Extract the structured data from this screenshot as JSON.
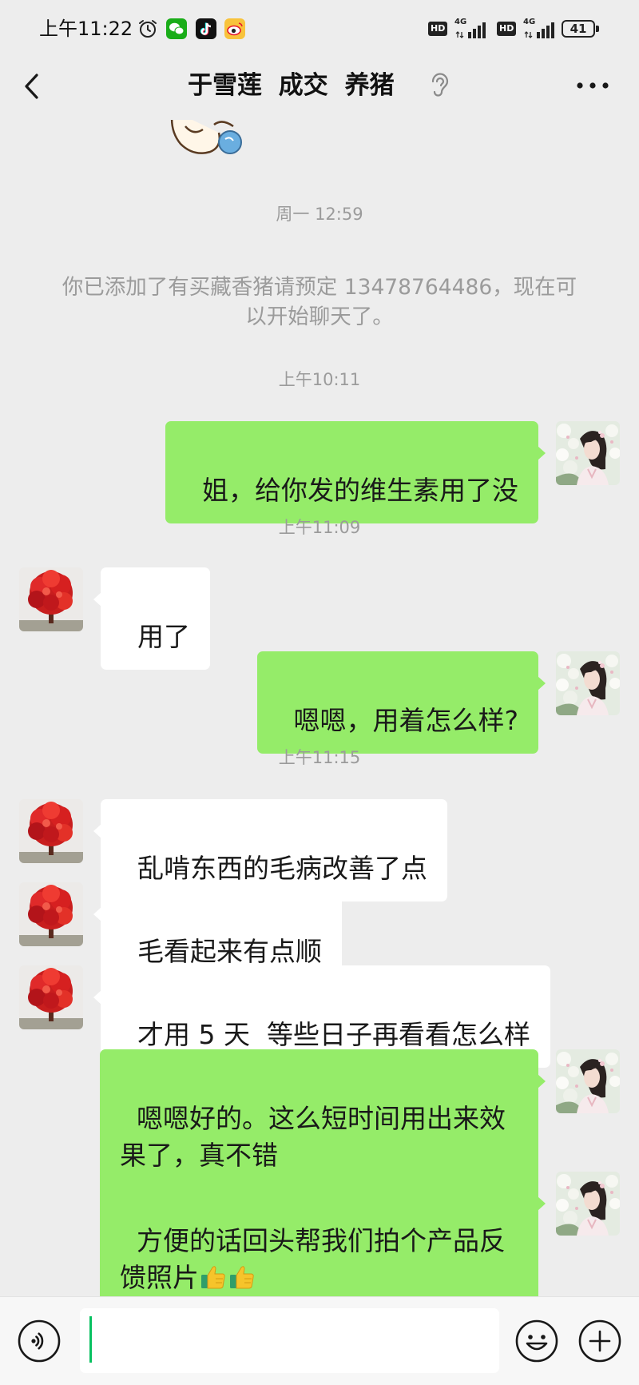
{
  "status_bar": {
    "time": "上午11:22",
    "left_icons": [
      "alarm-icon",
      "wechat-icon",
      "tiktok-icon",
      "weibo-icon"
    ],
    "networks": [
      {
        "badge": "HD",
        "type": "4G"
      },
      {
        "badge": "HD",
        "type": "4G"
      }
    ],
    "battery": "41"
  },
  "header": {
    "back_icon": "chevron-left-icon",
    "title": "于雪莲 成交 养猪",
    "mode_icon": "ear-icon",
    "more_icon": "more-dots-icon"
  },
  "chat": {
    "sticker_icon": "sticker-image",
    "timestamps": [
      "周一 12:59",
      "上午10:11",
      "上午11:09",
      "上午11:15"
    ],
    "system_notice": "你已添加了有买藏香猪请预定 13478764486，现在可以开始聊天了。",
    "self_avatar_icon": "woman-portrait-avatar",
    "contact_avatar_icon": "red-tree-avatar",
    "messages": [
      {
        "outgoing": true,
        "text": "姐，给你发的维生素用了没"
      },
      {
        "outgoing": false,
        "text": "用了"
      },
      {
        "outgoing": true,
        "text": "嗯嗯，用着怎么样?"
      },
      {
        "outgoing": false,
        "text": "乱啃东西的毛病改善了点"
      },
      {
        "outgoing": false,
        "text": "毛看起来有点顺"
      },
      {
        "outgoing": false,
        "text": "才用 5 天  等些日子再看看怎么样"
      },
      {
        "outgoing": true,
        "text": "嗯嗯好的。这么短时间用出来效果了，真不错"
      },
      {
        "outgoing": true,
        "text": "方便的话回头帮我们拍个产品反馈照片",
        "emoji": [
          "thumbs-up-icon",
          "thumbs-up-icon"
        ]
      }
    ]
  },
  "input_bar": {
    "value": "",
    "voice_icon": "voice-icon",
    "emoji_icon": "emoji-icon",
    "more_icon": "plus-icon"
  },
  "colors": {
    "background": "#ededed",
    "self_bubble": "#95ec69",
    "other_bubble": "#ffffff",
    "input_caret": "#07c160"
  }
}
